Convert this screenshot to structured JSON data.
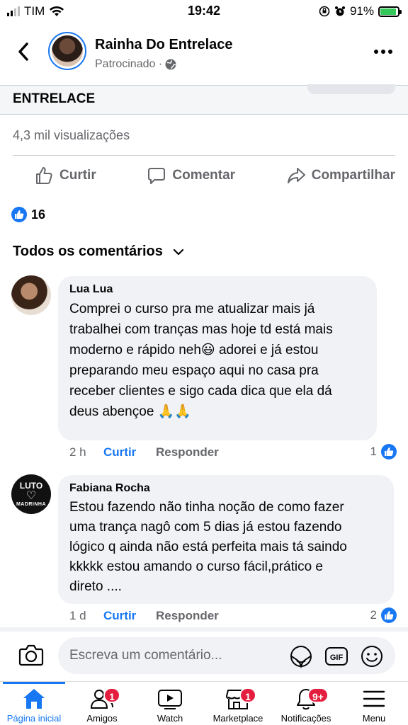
{
  "status_bar": {
    "carrier": "TIM",
    "time": "19:42",
    "battery": "91%"
  },
  "header": {
    "page_name": "Rainha Do Entrelace",
    "subtitle": "Patrocinado ·"
  },
  "post": {
    "brand_text": "ENTRELACE",
    "views": "4,3 mil visualizações",
    "actions": {
      "like": "Curtir",
      "comment": "Comentar",
      "share": "Compartilhar"
    },
    "reaction_count": "16"
  },
  "comments_section": {
    "filter_label": "Todos os comentários",
    "comments": [
      {
        "author": "Lua Lua",
        "lines": [
          "Comprei o curso pra me atualizar mais já",
          "trabalhei com tranças mas hoje td está mais",
          "moderno e rápido neh😃 adorei e já estou",
          "preparando meu espaço aqui no casa pra",
          "receber clientes e sigo cada dica que ela dá",
          "deus abençoe 🙏🙏"
        ],
        "age": "2 h",
        "like_label": "Curtir",
        "reply_label": "Responder",
        "likes": "1"
      },
      {
        "author": "Fabiana Rocha",
        "avatar_text": {
          "top": "LUTO",
          "bottom": "MADRINHA"
        },
        "lines": [
          "Estou fazendo não tinha noção de como fazer",
          "uma trança nagô com 5 dias já estou fazendo",
          "lógico q ainda não está perfeita mais tá saindo",
          "kkkkk estou amando o curso fácil,prático e",
          "direto ...."
        ],
        "age": "1 d",
        "like_label": "Curtir",
        "reply_label": "Responder",
        "likes": "2"
      }
    ]
  },
  "composer": {
    "placeholder": "Escreva um comentário...",
    "gif_label": "GIF"
  },
  "tabbar": {
    "tabs": [
      {
        "label": "Página inicial",
        "icon": "home-icon",
        "badge": ""
      },
      {
        "label": "Amigos",
        "icon": "friends-icon",
        "badge": "1"
      },
      {
        "label": "Watch",
        "icon": "watch-icon",
        "badge": ""
      },
      {
        "label": "Marketplace",
        "icon": "marketplace-icon",
        "badge": "1"
      },
      {
        "label": "Notificações",
        "icon": "bell-icon",
        "badge": "9+"
      },
      {
        "label": "Menu",
        "icon": "menu-icon",
        "badge": ""
      }
    ]
  },
  "colors": {
    "accent": "#1877f2",
    "badge": "#e41e3f",
    "muted": "#65676b",
    "bubble": "#f0f2f5"
  }
}
